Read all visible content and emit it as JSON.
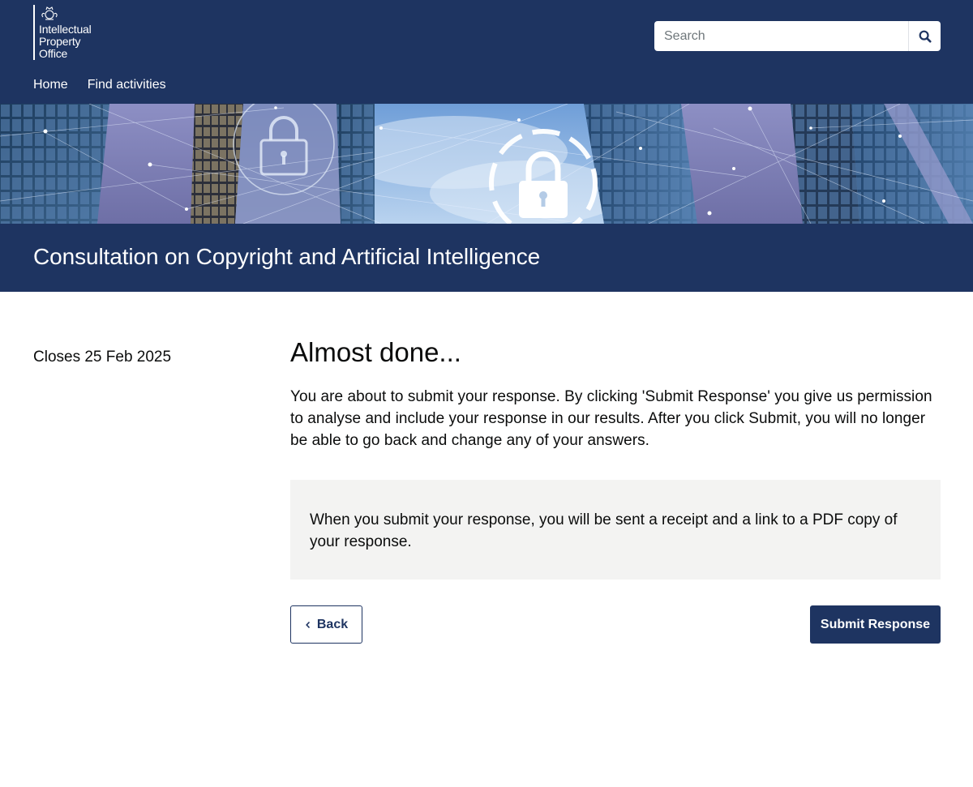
{
  "header": {
    "logo_lines": [
      "Intellectual",
      "Property",
      "Office"
    ],
    "search": {
      "placeholder": "Search",
      "icon": "search-icon"
    },
    "nav": [
      {
        "label": "Home"
      },
      {
        "label": "Find activities"
      }
    ]
  },
  "banner": {
    "icons": [
      "lock-icon",
      "lock-icon"
    ]
  },
  "title": "Consultation on Copyright and Artificial Intelligence",
  "sidebar": {
    "closes": "Closes 25 Feb 2025"
  },
  "main": {
    "heading": "Almost done...",
    "lead": "You are about to submit your response. By clicking 'Submit Response' you give us permission to analyse and include your response in our results. After you click Submit, you will no longer be able to go back and change any of your answers.",
    "notice": "When you submit your response, you will be sent a receipt and a link to a PDF copy of your response.",
    "back_label": "Back",
    "submit_label": "Submit Response"
  },
  "colors": {
    "brand_navy": "#1e3461",
    "notice_bg": "#f3f3f2"
  }
}
